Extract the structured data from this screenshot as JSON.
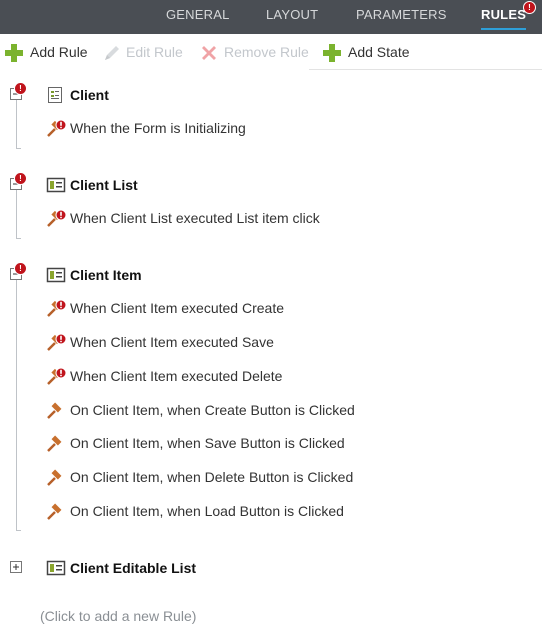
{
  "tabs": [
    {
      "label": "GENERAL"
    },
    {
      "label": "LAYOUT"
    },
    {
      "label": "PARAMETERS"
    },
    {
      "label": "RULES"
    }
  ],
  "tab_badge": "!",
  "toolbar": {
    "add_rule": "Add Rule",
    "edit_rule": "Edit Rule",
    "remove_rule": "Remove Rule",
    "add_state": "Add State"
  },
  "groups": [
    {
      "title": "Client",
      "rules": [
        "When the Form is Initializing"
      ]
    },
    {
      "title": "Client List",
      "rules": [
        "When Client List executed List item click"
      ]
    },
    {
      "title": "Client Item",
      "rules": [
        "When Client Item executed Create",
        "When Client Item executed Save",
        "When Client Item executed Delete",
        "On Client Item, when Create Button is Clicked",
        "On Client Item, when Save Button is Clicked",
        "On Client Item, when Delete Button is Clicked",
        "On Client Item, when Load Button is Clicked"
      ]
    },
    {
      "title": "Client Editable List",
      "rules": []
    }
  ],
  "add_new_rule": "(Click to add a new Rule)",
  "colors": {
    "tabbar": "#4a4e54",
    "accent": "#2e9fd8",
    "error": "#c0141c",
    "add_green": "#7bb32e",
    "remove_red": "#e2444b"
  }
}
